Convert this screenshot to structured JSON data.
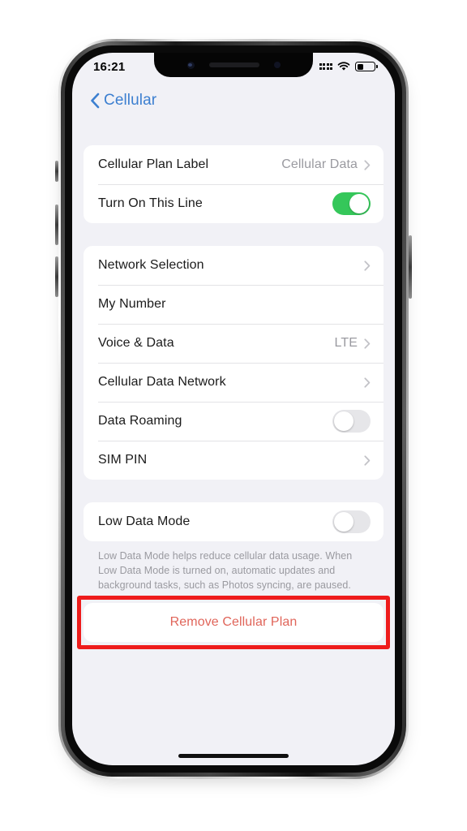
{
  "status_bar": {
    "time": "16:21",
    "signal_icon": "signal-dots-icon",
    "wifi_icon": "wifi-icon",
    "battery_icon": "battery-icon",
    "battery_level_percent": 34
  },
  "nav": {
    "back_icon": "chevron-left-icon",
    "back_label": "Cellular"
  },
  "groups": [
    {
      "rows": [
        {
          "label": "Cellular Plan Label",
          "value": "Cellular Data",
          "accessory": "chevron"
        },
        {
          "label": "Turn On This Line",
          "accessory": "toggle",
          "toggle_on": true
        }
      ]
    },
    {
      "rows": [
        {
          "label": "Network Selection",
          "accessory": "chevron"
        },
        {
          "label": "My Number",
          "accessory": "none"
        },
        {
          "label": "Voice & Data",
          "value": "LTE",
          "accessory": "chevron"
        },
        {
          "label": "Cellular Data Network",
          "accessory": "chevron"
        },
        {
          "label": "Data Roaming",
          "accessory": "toggle",
          "toggle_on": false
        },
        {
          "label": "SIM PIN",
          "accessory": "chevron"
        }
      ]
    },
    {
      "rows": [
        {
          "label": "Low Data Mode",
          "accessory": "toggle",
          "toggle_on": false
        }
      ],
      "footnote": "Low Data Mode helps reduce cellular data usage. When Low Data Mode is turned on, automatic updates and background tasks, such as Photos syncing, are paused."
    }
  ],
  "destructive_action": {
    "label": "Remove Cellular Plan",
    "highlighted": true
  },
  "colors": {
    "accent_blue": "#3c7fd0",
    "toggle_on_green": "#35c75a",
    "destructive_red": "#e0655a",
    "annotation_red": "#ee1c1c",
    "screen_background": "#f1f1f6",
    "card_background": "#ffffff"
  },
  "home_indicator": "home-indicator"
}
